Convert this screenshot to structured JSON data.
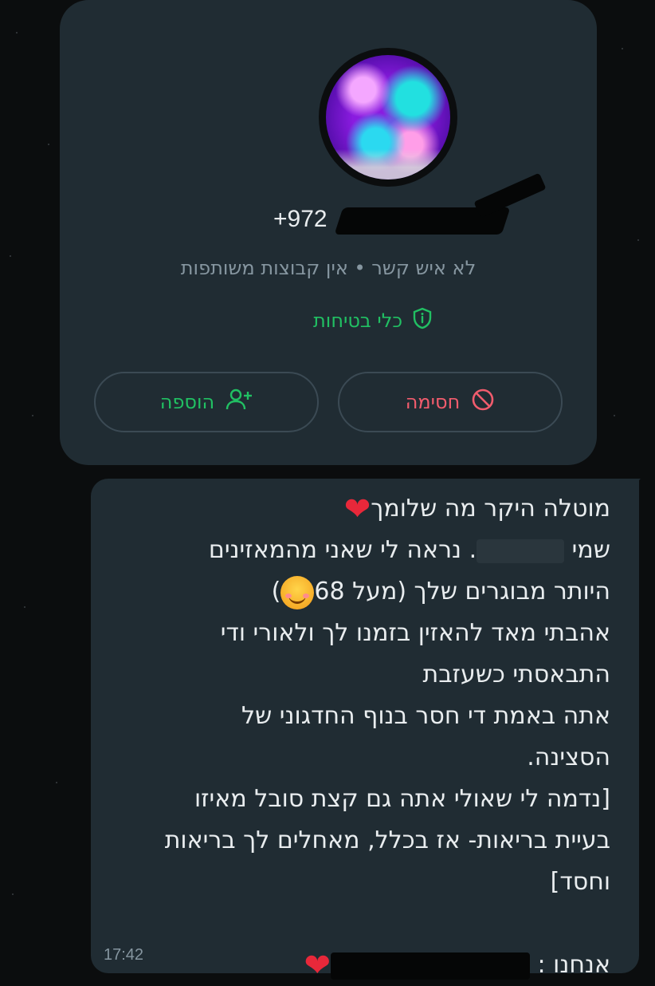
{
  "contact_card": {
    "phone_prefix": "+972",
    "subtitle": "לא איש קשר • אין קבוצות משותפות",
    "safety_tools_label": "כלי בטיחות",
    "block_label": "חסימה",
    "add_label": "הוספה"
  },
  "message": {
    "lines": [
      "מוטלה היקר מה שלומך",
      "שמי",
      ". נראה לי שאני מהמאזינים",
      "היותר מבוגרים שלך (מעל 68",
      ")",
      "אהבתי מאד להאזין בזמנו לך ולאורי ודי",
      "התבאסתי כשעזבת",
      "אתה באמת די חסר בנוף החדגוני של",
      "הסצינה.",
      "[נדמה לי שאולי אתה גם קצת סובל מאיזו",
      "בעיית בריאות- אז בכלל, מאחלים לך בריאות",
      "וחסד]",
      "אנחנו :"
    ],
    "time": "17:42"
  },
  "colors": {
    "background": "#0b0d0e",
    "card": "#202c33",
    "green_accent": "#21c063",
    "red_accent": "#f15c6d",
    "muted_text": "#8696a0"
  },
  "icons": [
    "shield-icon",
    "block-icon",
    "add-person-icon",
    "heart-emoji",
    "smiling-blush-emoji"
  ]
}
